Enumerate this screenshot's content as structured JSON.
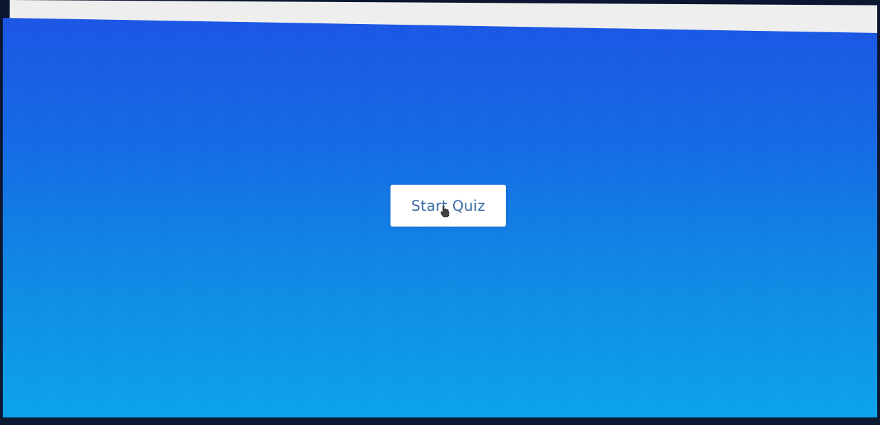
{
  "main": {
    "start_button_label": "Start Quiz"
  },
  "colors": {
    "gradient_top": "#1a55e6",
    "gradient_bottom": "#0aa4ec",
    "button_bg": "#ffffff",
    "button_text": "#3c6fa8",
    "topbar": "#eeeeee"
  },
  "icons": {
    "cursor": "hand-pointer-icon"
  }
}
